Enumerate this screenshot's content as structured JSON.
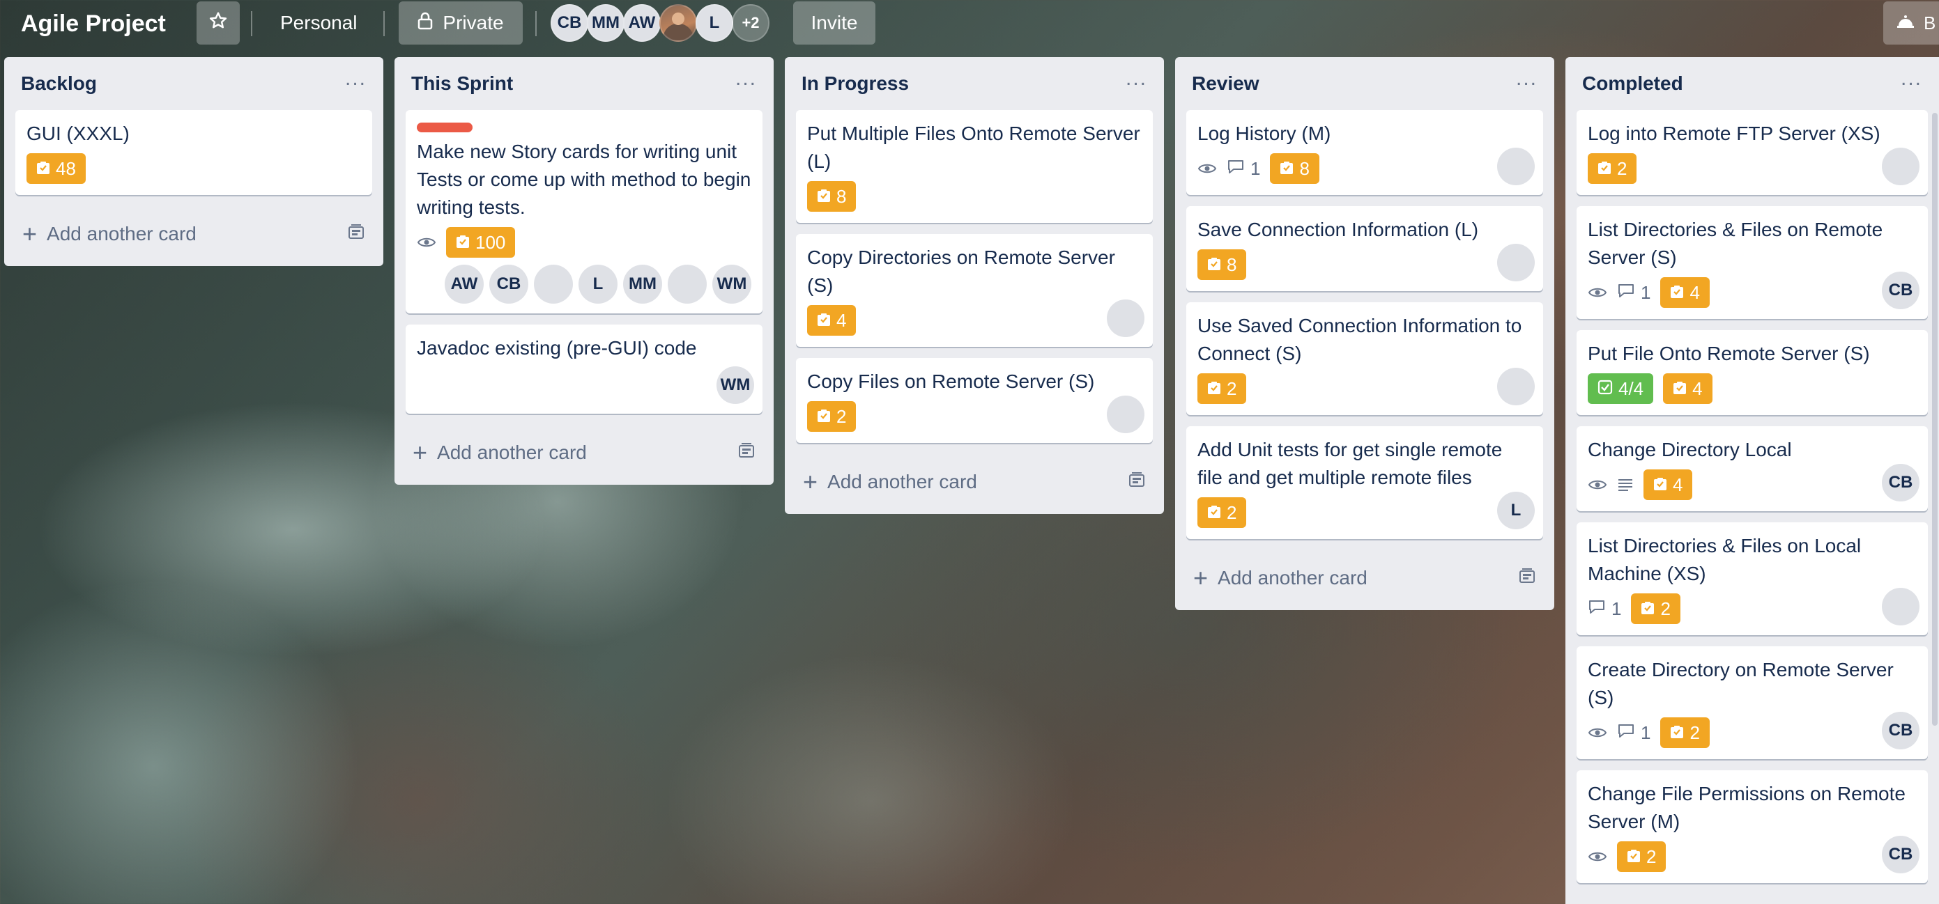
{
  "header": {
    "board_title": "Agile Project",
    "star_icon": "star-icon",
    "personal_label": "Personal",
    "private_label": "Private",
    "members": [
      "CB",
      "MM",
      "AW",
      "",
      "L"
    ],
    "more_members": "+2",
    "invite_label": "Invite",
    "right_label": "B"
  },
  "lists": [
    {
      "title": "Backlog",
      "cards": [
        {
          "title": "GUI (XXXL)",
          "estimate": "48"
        }
      ],
      "add_card": "Add another card"
    },
    {
      "title": "This Sprint",
      "cards": [
        {
          "title": "Make new Story cards for writing unit Tests or come up with method to begin writing tests.",
          "estimate": "100",
          "members": [
            "AW",
            "CB",
            "",
            "L",
            "MM",
            "",
            "WM"
          ]
        },
        {
          "title": "Javadoc existing (pre-GUI) code",
          "member": "WM"
        }
      ],
      "add_card": "Add another card"
    },
    {
      "title": "In Progress",
      "cards": [
        {
          "title": "Put Multiple Files Onto Remote Server (L)",
          "estimate": "8"
        },
        {
          "title": "Copy Directories on Remote Server (S)",
          "estimate": "4"
        },
        {
          "title": "Copy Files on Remote Server (S)",
          "estimate": "2"
        }
      ],
      "add_card": "Add another card"
    },
    {
      "title": "Review",
      "cards": [
        {
          "title": "Log History (M)",
          "comments": "1",
          "estimate": "8"
        },
        {
          "title": "Save Connection Information (L)",
          "estimate": "8"
        },
        {
          "title": "Use Saved Connection Information to Connect (S)",
          "estimate": "2"
        },
        {
          "title": "Add Unit tests for get single remote file and get multiple remote files",
          "estimate": "2",
          "member": "L"
        }
      ],
      "add_card": "Add another card"
    },
    {
      "title": "Completed",
      "cards": [
        {
          "title": "Log into Remote FTP Server (XS)",
          "estimate": "2"
        },
        {
          "title": "List Directories & Files on Remote Server (S)",
          "comments": "1",
          "estimate": "4",
          "member": "CB"
        },
        {
          "title": "Put File Onto Remote Server (S)",
          "checklist": "4/4",
          "estimate": "4"
        },
        {
          "title": "Change Directory Local",
          "estimate": "4",
          "member": "CB"
        },
        {
          "title": "List Directories & Files on Local Machine (XS)",
          "comments": "1",
          "estimate": "2"
        },
        {
          "title": "Create Directory on Remote Server (S)",
          "comments": "1",
          "estimate": "2",
          "member": "CB"
        },
        {
          "title": "Change File Permissions on Remote Server (M)",
          "estimate": "2",
          "member": "CB"
        }
      ]
    }
  ],
  "colors": {
    "estimate_badge": "#f2a623",
    "checklist_complete": "#61bd4f",
    "label_red": "#eb5a46",
    "list_bg": "#ebecf0"
  }
}
